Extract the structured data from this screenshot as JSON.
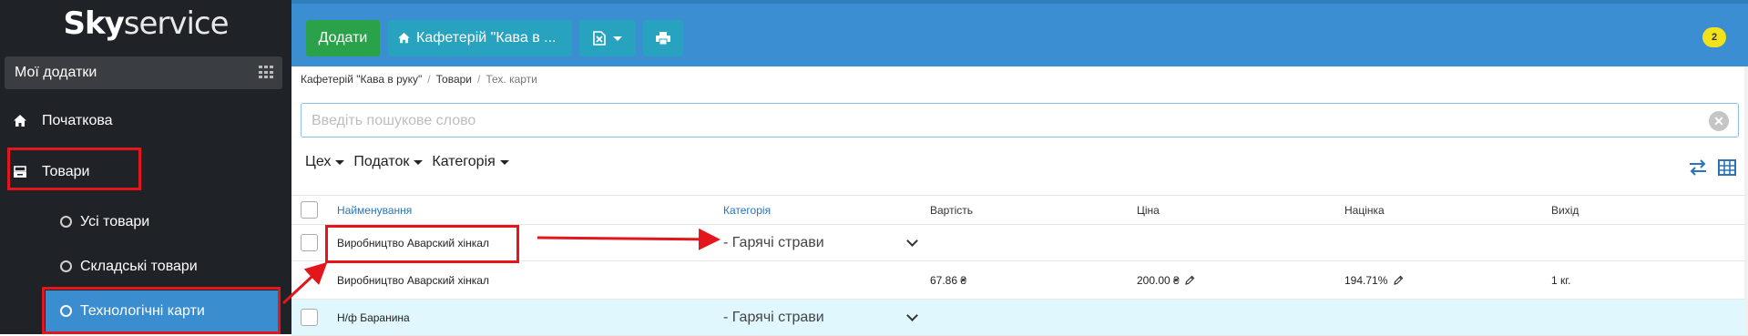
{
  "brand": {
    "logo_bold": "Sky",
    "logo_light": "service"
  },
  "sidebar": {
    "my_apps": "Мої додатки",
    "items": [
      {
        "label": "Початкова",
        "icon": "home-icon"
      },
      {
        "label": "Товари",
        "icon": "box-icon"
      }
    ],
    "subitems": [
      {
        "label": "Усі товари"
      },
      {
        "label": "Складські товари"
      },
      {
        "label": "Технологічні карти"
      }
    ]
  },
  "toolbar": {
    "add_label": "Додати",
    "store_label": "Кафетерій \"Кава в ...",
    "notifications_count": "2"
  },
  "breadcrumb": {
    "store": "Кафетерій \"Кава в руку\"",
    "goods": "Товари",
    "current": "Тех. карти",
    "sep": "/"
  },
  "search": {
    "placeholder": "Введіть пошукове слово"
  },
  "filters": {
    "workshop": "Цех",
    "tax": "Податок",
    "category": "Категорія"
  },
  "table": {
    "headers": {
      "name": "Найменування",
      "category": "Категорія",
      "cost": "Вартість",
      "price": "Ціна",
      "markup": "Націнка",
      "output": "Вихід"
    },
    "rows": [
      {
        "name": "Виробництво Аварский хінкал",
        "category": "- Гарячі страви"
      },
      {
        "name": "Виробництво Аварский хінкал",
        "cost": "67.86 ₴",
        "price": "200.00 ₴",
        "markup": "194.71%",
        "output": "1 кг."
      },
      {
        "name": "Н/ф Баранина",
        "category": "- Гарячі страви"
      }
    ]
  },
  "colors": {
    "sidebar_bg": "#1f2227",
    "topbar": "#3b8ed1",
    "add_btn": "#2aa24a",
    "info_btn": "#27a3c0",
    "active_item": "#3a8ed0",
    "annotation": "#e3161b",
    "highlight_row": "#e0f7fd"
  }
}
